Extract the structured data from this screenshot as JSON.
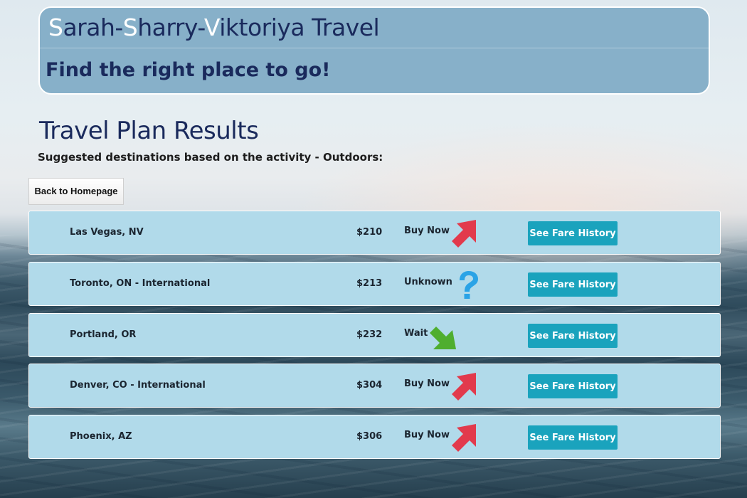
{
  "header": {
    "title_letter_1": "S",
    "title_part_1": "arah-",
    "title_letter_2": "S",
    "title_part_2": "harry-",
    "title_letter_3": "V",
    "title_part_3": "iktoriya Travel",
    "subtitle": "Find the right place to go!"
  },
  "results": {
    "title": "Travel Plan Results",
    "subtitle": "Suggested destinations based on the activity - Outdoors:"
  },
  "back_button_label": "Back to Homepage",
  "colors": {
    "buy_now": "#e23a4c",
    "unknown": "#2aa3e6",
    "wait": "#4fae2f",
    "fare_button": "#1aa3bd"
  },
  "destinations": [
    {
      "city": "Las Vegas, NV",
      "price": "$210",
      "advice": "Buy Now",
      "icon": "arrow-up-right-icon",
      "fare_label": "See Fare History"
    },
    {
      "city": "Toronto, ON - International",
      "price": "$213",
      "advice": "Unknown",
      "icon": "question-mark-icon",
      "fare_label": "See Fare History"
    },
    {
      "city": "Portland, OR",
      "price": "$232",
      "advice": "Wait",
      "icon": "arrow-down-right-icon",
      "fare_label": "See Fare History"
    },
    {
      "city": "Denver, CO - International",
      "price": "$304",
      "advice": "Buy Now",
      "icon": "arrow-up-right-icon",
      "fare_label": "See Fare History"
    },
    {
      "city": "Phoenix, AZ",
      "price": "$306",
      "advice": "Buy Now",
      "icon": "arrow-up-right-icon",
      "fare_label": "See Fare History"
    }
  ]
}
